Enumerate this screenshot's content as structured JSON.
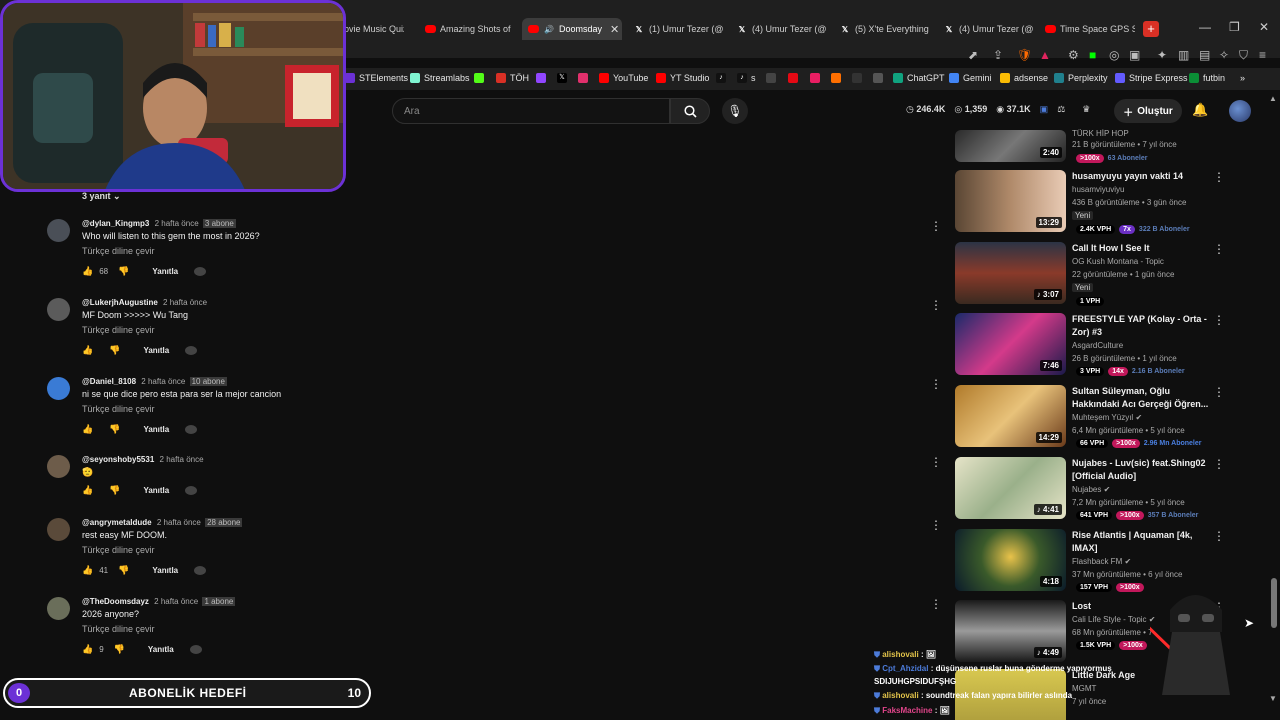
{
  "browser": {
    "tabs": [
      {
        "label": "ovie Music Quiz, I",
        "icon": "none-icon"
      },
      {
        "label": "Amazing Shots of G",
        "icon": "youtube-icon"
      },
      {
        "label": "Doomsday",
        "icon": "youtube-icon",
        "active": true
      },
      {
        "label": "(1) Umur Tezer (@U",
        "icon": "x-icon"
      },
      {
        "label": "(4) Umur Tezer (@U",
        "icon": "x-icon"
      },
      {
        "label": "(5) X'te Everything",
        "icon": "x-icon"
      },
      {
        "label": "(4) Umur Tezer (@U",
        "icon": "x-icon"
      },
      {
        "label": "Time Space GPS Sc",
        "icon": "youtube-icon"
      }
    ],
    "bookmarks": [
      {
        "label": "STElements",
        "color": "#6c31d6"
      },
      {
        "label": "Streamlabs",
        "color": "#80f5d2"
      },
      {
        "label": "",
        "color": "#53fc18"
      },
      {
        "label": "TÖH",
        "color": "#d93025"
      },
      {
        "label": "",
        "color": "#9146ff"
      },
      {
        "label": "",
        "color": "#000000"
      },
      {
        "label": "",
        "color": "#e1306c"
      },
      {
        "label": "YouTube",
        "color": "#ff0000"
      },
      {
        "label": "YT Studio",
        "color": "#ff0000"
      },
      {
        "label": "s",
        "color": "#111111"
      },
      {
        "label": "",
        "color": "#444444"
      },
      {
        "label": "",
        "color": "#e50914"
      },
      {
        "label": "",
        "color": "#e91e63"
      },
      {
        "label": "",
        "color": "#ff6f00"
      },
      {
        "label": "",
        "color": "#333333"
      },
      {
        "label": "",
        "color": "#555555"
      },
      {
        "label": "ChatGPT",
        "color": "#10a37f"
      },
      {
        "label": "Gemini",
        "color": "#4285f4"
      },
      {
        "label": "adsense",
        "color": "#fbbc04"
      },
      {
        "label": "Perplexity",
        "color": "#20808d"
      },
      {
        "label": "Stripe Express",
        "color": "#635bff"
      },
      {
        "label": "futbin",
        "color": "#0b8e36"
      }
    ]
  },
  "header": {
    "search_placeholder": "Ara",
    "stats": {
      "a": "246.4K",
      "b": "1,359",
      "c": "37.1K"
    },
    "create_label": "Oluştur"
  },
  "comments": {
    "replies_toggle": "3 yanıt",
    "items": [
      {
        "user": "@dylan_Kingmp3",
        "time": "2 hafta önce",
        "subs": "3 abone",
        "text": "Who will listen to this gem the most in 2026?",
        "translate": "Türkçe diline çevir",
        "likes": "68",
        "reply": "Yanıtla",
        "avatar": "#4a4f57"
      },
      {
        "user": "@LukerjhAugustine",
        "time": "2 hafta önce",
        "subs": "",
        "text": "MF Doom >>>>> Wu Tang",
        "translate": "Türkçe diline çevir",
        "likes": "",
        "reply": "Yanıtla",
        "avatar": "#5b5b5b"
      },
      {
        "user": "@Daniel_8108",
        "time": "2 hafta önce",
        "subs": "10 abone",
        "text": "ni se que dice pero esta para ser la mejor cancion",
        "translate": "Türkçe diline çevir",
        "likes": "",
        "reply": "Yanıtla",
        "avatar": "#3a7bd5"
      },
      {
        "user": "@seyonshoby5531",
        "time": "2 hafta önce",
        "subs": "",
        "text": "🫡",
        "translate": "",
        "likes": "",
        "reply": "Yanıtla",
        "avatar": "#6d5c4a"
      },
      {
        "user": "@angrymetaldude",
        "time": "2 hafta önce",
        "subs": "28 abone",
        "text": "rest easy MF DOOM.",
        "translate": "Türkçe diline çevir",
        "likes": "41",
        "reply": "Yanıtla",
        "avatar": "#5a4a3a"
      },
      {
        "user": "@TheDoomsdayz",
        "time": "2 hafta önce",
        "subs": "1 abone",
        "text": "2026 anyone?",
        "translate": "Türkçe diline çevir",
        "likes": "9",
        "reply": "Yanıtla",
        "avatar": "#6a6e5a"
      }
    ]
  },
  "sidebar": {
    "videos": [
      {
        "title": "TÜRK HİP HOP",
        "channel": "",
        "meta": "21 B görüntüleme • 7 yıl önce",
        "dur": "2:40",
        "isnew": false,
        "vph": "",
        "mult": ">100x",
        "multColor": "pink",
        "subs": "63 Aboneler",
        "subsMuted": true,
        "thumb": "linear-gradient(135deg,#2a2a2a,#777,#222)"
      },
      {
        "title": "husamyuyu yayın vakti 14",
        "channel": "husamviyuviyu",
        "meta": "436 B görüntüleme • 3 gün önce",
        "dur": "13:29",
        "isnew": true,
        "vph": "2.4K VPH",
        "mult": "7x",
        "multColor": "purple",
        "subs": "322 B Aboneler",
        "subsMuted": true,
        "thumb": "linear-gradient(90deg,#5a4634,#b08a6a 50%,#e9cbb5)"
      },
      {
        "title": "Call It How I See It",
        "channel": "OG Kush Montana - Topic",
        "meta": "22 görüntüleme • 1 gün önce",
        "dur": "3:07",
        "isnew": true,
        "vph": "1 VPH",
        "mult": "",
        "multColor": "",
        "subs": "",
        "subsMuted": false,
        "thumb": "linear-gradient(180deg,#2b3445,#8a3a2a,#3a2a20)"
      },
      {
        "title": "FREESTYLE YAP (Kolay - Orta - Zor) #3",
        "channel": "AsgardCulture",
        "meta": "26 B görüntüleme • 1 yıl önce",
        "dur": "7:46",
        "isnew": false,
        "vph": "3 VPH",
        "mult": "14x",
        "multColor": "pink",
        "subs": "2.16 B Aboneler",
        "subsMuted": true,
        "thumb": "linear-gradient(135deg,#1a2a6a,#d43a8a,#1a1a4a)"
      },
      {
        "title": "Sultan Süleyman, Oğlu Hakkındaki Acı Gerçeği Öğren...",
        "channel": "Muhteşem Yüzyıl",
        "meta": "6,4 Mn görüntüleme • 5 yıl önce",
        "dur": "14:29",
        "isnew": false,
        "vph": "66 VPH",
        "mult": ">100x",
        "multColor": "pink",
        "subs": "2.96 Mn Aboneler",
        "subsMuted": false,
        "thumb": "linear-gradient(135deg,#b07a2a,#e8c27a,#6a3a1a)"
      },
      {
        "title": "Nujabes - Luv(sic) feat.Shing02 [Official Audio]",
        "channel": "Nujabes",
        "meta": "7,2 Mn görüntüleme • 5 yıl önce",
        "dur": "4:41",
        "isnew": false,
        "vph": "641 VPH",
        "mult": ">100x",
        "multColor": "pink",
        "subs": "357 B Aboneler",
        "subsMuted": true,
        "thumb": "linear-gradient(135deg,#e6e4c8,#9ab08a,#e6e4c8)"
      },
      {
        "title": "Rise Atlantis | Aquaman [4k, IMAX]",
        "channel": "Flashback FM",
        "meta": "37 Mn görüntüleme • 6 yıl önce",
        "dur": "4:18",
        "isnew": false,
        "vph": "157 VPH",
        "mult": ">100x",
        "multColor": "pink",
        "subs": "",
        "subsMuted": false,
        "thumb": "radial-gradient(circle at 50% 45%,#e8c24a,#3a5a2a 45%,#0a1a2a)"
      },
      {
        "title": "Lost",
        "channel": "Cali Life Style - Topic",
        "meta": "68 Mn görüntüleme • 7",
        "dur": "4:49",
        "isnew": false,
        "vph": "1.5K VPH",
        "mult": ">100x",
        "multColor": "pink",
        "subs": "",
        "subsMuted": false,
        "thumb": "linear-gradient(180deg,#1a1a1a,#9a9a9a,#1a1a1a)"
      },
      {
        "title": "Little Dark Age",
        "channel": "MGMT",
        "meta": "7 yıl önce",
        "dur": "",
        "isnew": false,
        "vph": "",
        "mult": "",
        "multColor": "",
        "subs": "",
        "subsMuted": false,
        "thumb": "linear-gradient(180deg,#d8c850,#a8983a)"
      }
    ]
  },
  "overlay": {
    "goal_count": "0",
    "goal_label": "ABONELİK HEDEFİ",
    "goal_target": "10",
    "chat": [
      {
        "user": "alishovali",
        "sep": ":",
        "msg": "🖼",
        "color": "gold"
      },
      {
        "user": "Cpt_Ahzidal",
        "sep": ":",
        "msg": "düşünsene ruslar buna gönderme yapıyormuş",
        "color": "blue"
      },
      {
        "user": "",
        "sep": "",
        "msg": "SDIJUHGPSIDUFŞHG",
        "color": "blue"
      },
      {
        "user": "alishovali",
        "sep": ":",
        "msg": "soundtreak falan yapıra bilirler aslında",
        "color": "gold"
      },
      {
        "user": "FaksMachine",
        "sep": ":",
        "msg": "🖼",
        "color": "pink"
      }
    ]
  },
  "colors": {
    "accent": "#6c31d6",
    "youtube_red": "#ff0000"
  }
}
